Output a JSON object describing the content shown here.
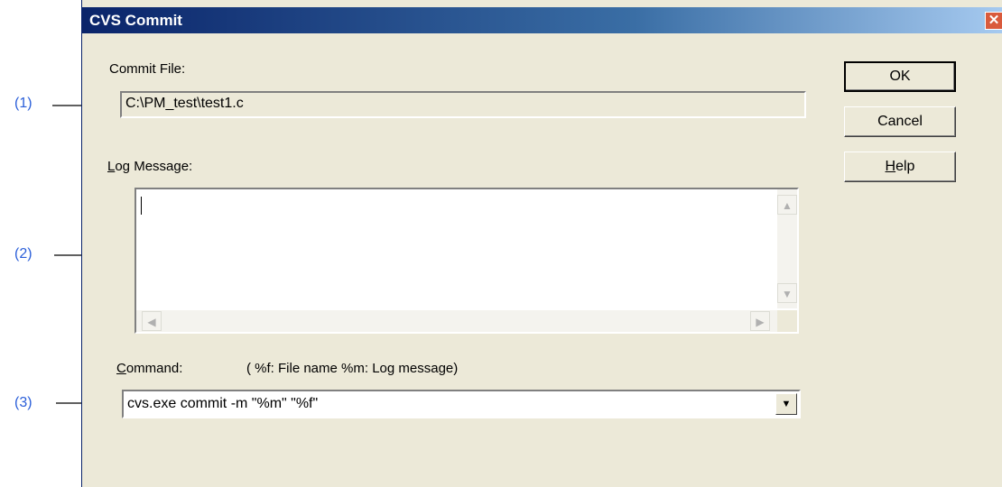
{
  "annotations": [
    {
      "id": "1",
      "label": "(1)"
    },
    {
      "id": "2",
      "label": "(2)"
    },
    {
      "id": "3",
      "label": "(3)"
    }
  ],
  "dialog": {
    "title": "CVS Commit",
    "close_glyph": "✕",
    "commit_file_label": "Commit File:",
    "commit_file_value": "C:\\PM_test\\test1.c",
    "log_message_label_mnemonic": "L",
    "log_message_label_rest": "og Message:",
    "log_message_value": "",
    "command_label_mnemonic": "C",
    "command_label_rest": "ommand:",
    "command_hint": "( %f: File name %m: Log message)",
    "command_value": "cvs.exe commit -m \"%m\" \"%f\"",
    "buttons": {
      "ok": "OK",
      "cancel": "Cancel",
      "help_mnemonic": "H",
      "help_rest": "elp"
    },
    "icons": {
      "scroll_up": "▲",
      "scroll_down": "▼",
      "scroll_left": "◀",
      "scroll_right": "▶",
      "dropdown": "▼"
    }
  }
}
